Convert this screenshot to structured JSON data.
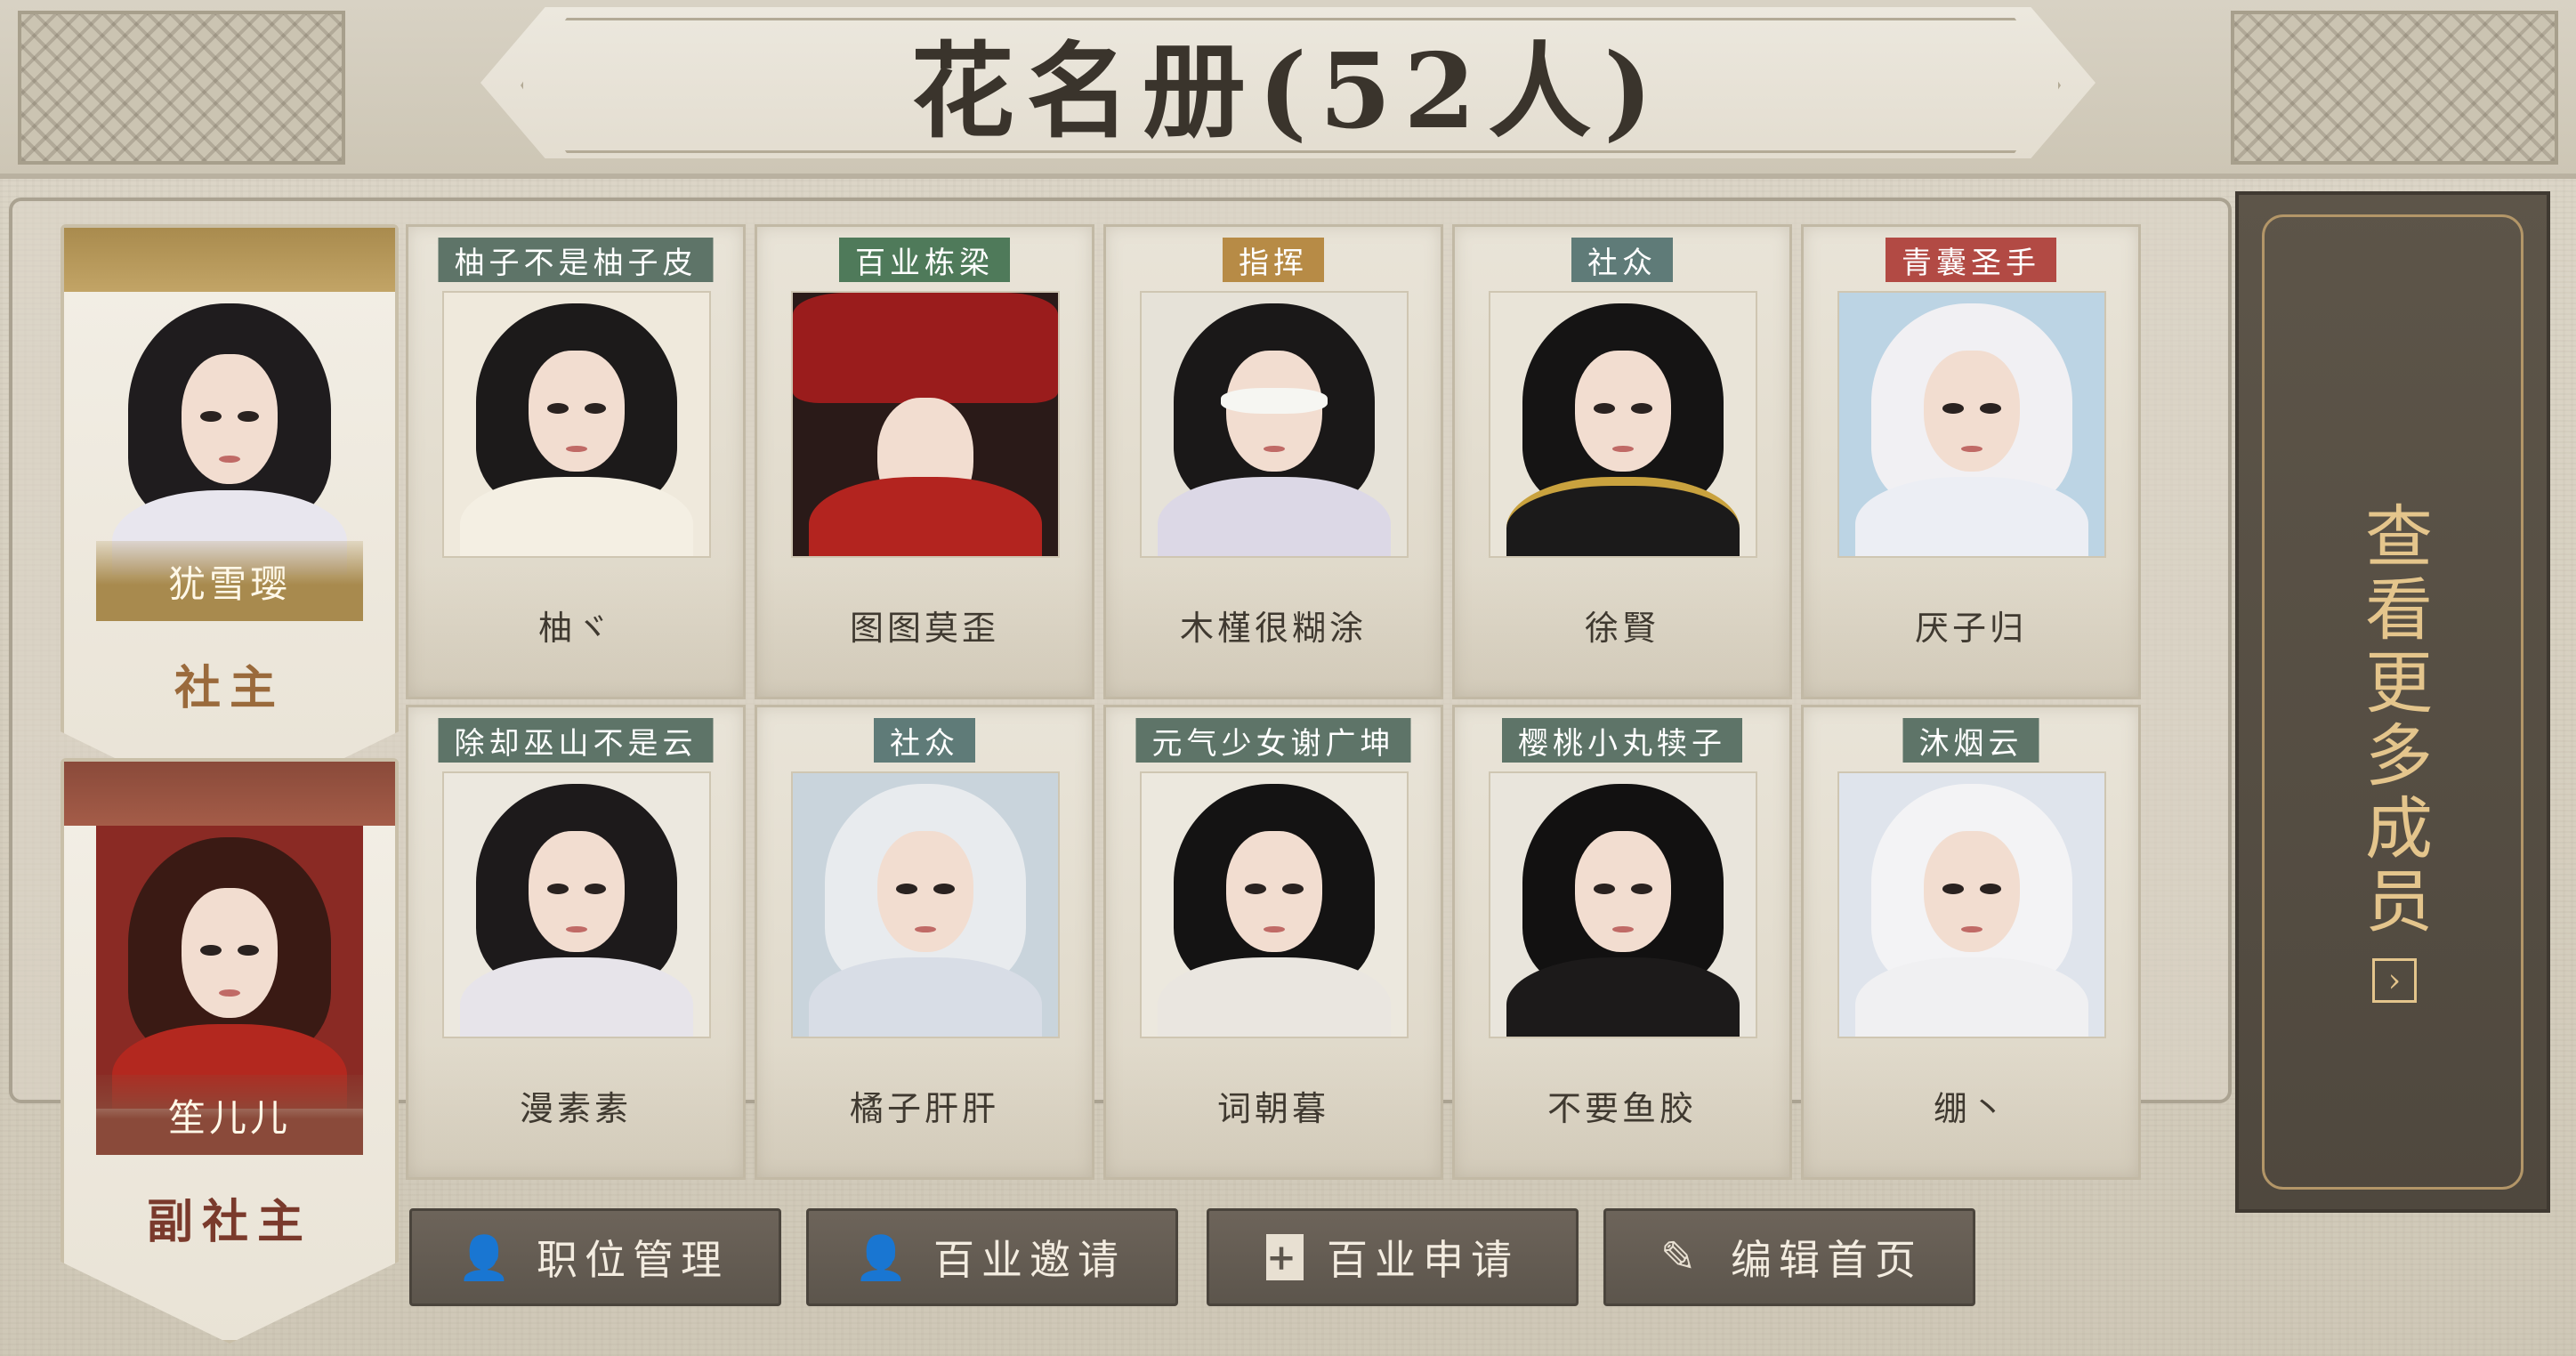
{
  "header": {
    "title": "花名册(52人)"
  },
  "leaders": [
    {
      "name": "犹雪璎",
      "role": "社主",
      "accent": "#a98b4e"
    },
    {
      "name": "笙儿儿",
      "role": "副社主",
      "accent": "#8a4a3a"
    }
  ],
  "members": [
    {
      "tag": "柚子不是柚子皮",
      "name": "柚ヾ",
      "tag_color": "#5e7468"
    },
    {
      "tag": "百业栋梁",
      "name": "图图莫歪",
      "tag_color": "#4f7a5a"
    },
    {
      "tag": "指挥",
      "name": "木槿很糊涂",
      "tag_color": "#b78b46"
    },
    {
      "tag": "社众",
      "name": "徐賢",
      "tag_color": "#5f7b78"
    },
    {
      "tag": "青囊圣手",
      "name": "厌子归",
      "tag_color": "#b24a44"
    },
    {
      "tag": "除却巫山不是云",
      "name": "漫素素",
      "tag_color": "#5e7468"
    },
    {
      "tag": "社众",
      "name": "橘子肝肝",
      "tag_color": "#5f7b78"
    },
    {
      "tag": "元气少女谢广坤",
      "name": "词朝暮",
      "tag_color": "#5e7468"
    },
    {
      "tag": "樱桃小丸犊子",
      "name": "不要鱼胶",
      "tag_color": "#5e7468"
    },
    {
      "tag": "沐烟云",
      "name": "绷丶",
      "tag_color": "#5e7468"
    }
  ],
  "actions": [
    {
      "label": "职位管理",
      "icon": "person-manage-icon"
    },
    {
      "label": "百业邀请",
      "icon": "person-add-icon"
    },
    {
      "label": "百业申请",
      "icon": "document-plus-icon"
    },
    {
      "label": "编辑首页",
      "icon": "brush-icon"
    }
  ],
  "view_more": {
    "label": "查看更多成员",
    "icon": "chevron-right-icon"
  }
}
